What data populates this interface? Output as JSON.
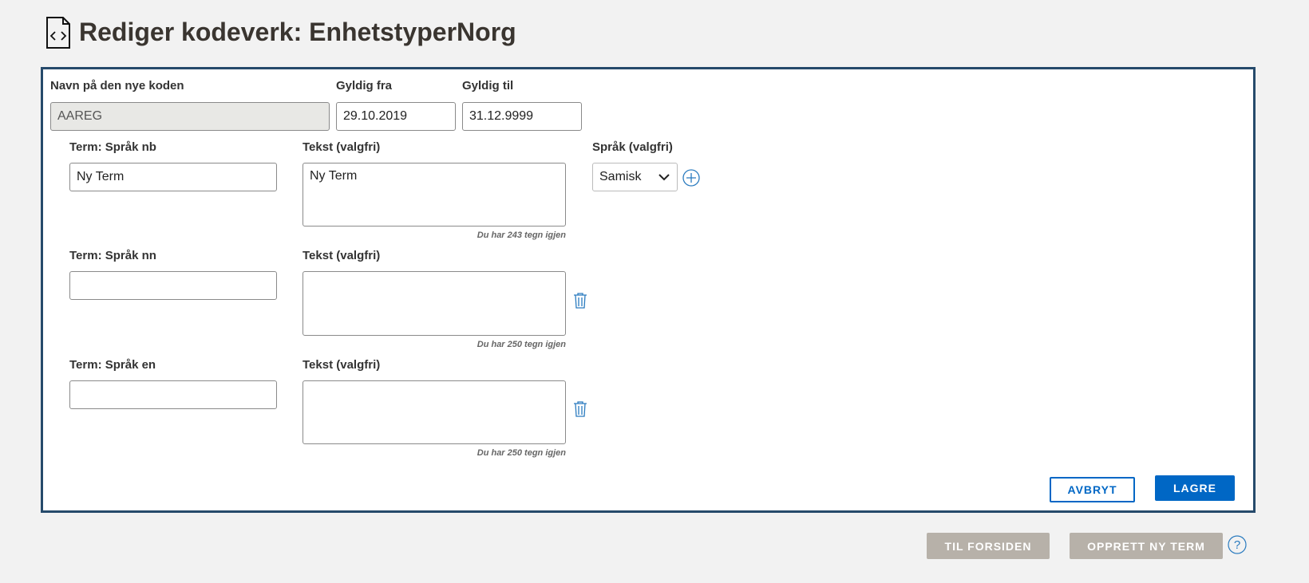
{
  "header": {
    "title": "Rediger kodeverk: EnhetstyperNorg",
    "icon": "code-file-icon"
  },
  "form": {
    "name_label": "Navn på den nye koden",
    "name_value": "AAREG",
    "from_label": "Gyldig fra",
    "from_value": "29.10.2019",
    "to_label": "Gyldig til",
    "to_value": "31.12.9999",
    "terms": [
      {
        "label": "Term: Språk nb",
        "value": "Ny Term",
        "text_label": "Tekst (valgfri)",
        "text_value": "Ny Term",
        "counter": "Du har 243 tegn igjen"
      },
      {
        "label": "Term: Språk nn",
        "value": "",
        "text_label": "Tekst (valgfri)",
        "text_value": "",
        "counter": "Du har 250 tegn igjen"
      },
      {
        "label": "Term: Språk en",
        "value": "",
        "text_label": "Tekst (valgfri)",
        "text_value": "",
        "counter": "Du har 250 tegn igjen"
      }
    ],
    "language_label": "Språk (valgfri)",
    "language_value": "Samisk",
    "cancel": "AVBRYT",
    "save": "LAGRE"
  },
  "footer": {
    "home": "TIL FORSIDEN",
    "new_term": "OPPRETT NY TERM"
  },
  "colors": {
    "primary": "#0067c5",
    "border": "#264a6b",
    "disabled": "#b7b1a9"
  }
}
